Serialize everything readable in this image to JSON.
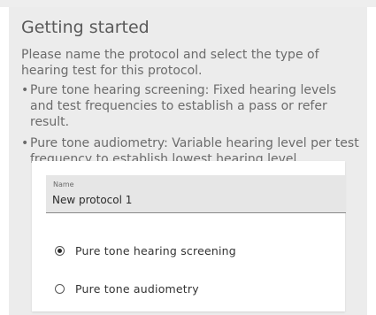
{
  "page": {
    "title": "Getting started",
    "intro": "Please name the protocol and select the type of hearing test for this protocol.",
    "bullets": [
      "Pure tone hearing screening: Fixed hearing levels and test frequencies to establish a pass or refer result.",
      "Pure tone audiometry: Variable hearing level per test frequency to establish lowest hearing level."
    ]
  },
  "form": {
    "name_label": "Name",
    "name_value": "New protocol 1",
    "test_type": {
      "selected": "screening",
      "options": [
        {
          "id": "screening",
          "label": "Pure tone hearing screening"
        },
        {
          "id": "audiometry",
          "label": "Pure tone audiometry"
        }
      ]
    }
  }
}
